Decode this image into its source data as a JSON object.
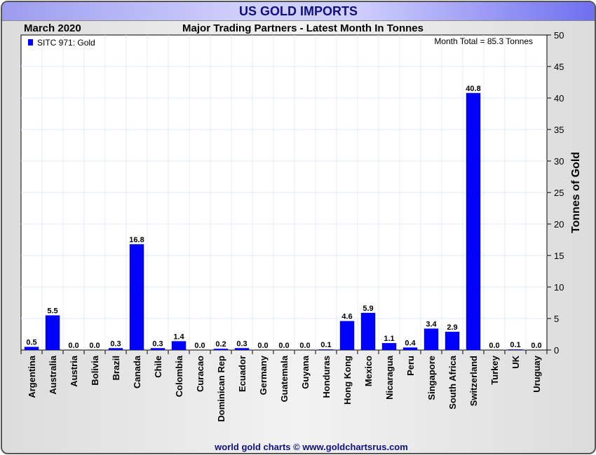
{
  "header": {
    "title": "US GOLD IMPORTS",
    "date": "March 2020",
    "footer": "world gold charts © www.goldchartsrus.com"
  },
  "chart_data": {
    "type": "bar",
    "title": "Major Trading Partners - Latest Month In Tonnes",
    "annotation": "Month Total = 85.3 Tonnes",
    "legend": [
      "SITC 971: Gold"
    ],
    "legend_placement": "top-left",
    "ylabel": "Tonnes of Gold",
    "xlabel": "",
    "ylim": [
      0,
      50
    ],
    "yticks": [
      0,
      5,
      10,
      15,
      20,
      25,
      30,
      35,
      40,
      45,
      50
    ],
    "grid": true,
    "bar_color": "#0000ff",
    "categories": [
      "Argentina",
      "Australia",
      "Austria",
      "Bolivia",
      "Brazil",
      "Canada",
      "Chile",
      "Colombia",
      "Curacao",
      "Dominican Rep",
      "Ecuador",
      "Germany",
      "Guatemala",
      "Guyana",
      "Honduras",
      "Hong Kong",
      "Mexico",
      "Nicaragua",
      "Peru",
      "Singapore",
      "South Africa",
      "Switzerland",
      "Turkey",
      "UK",
      "Uruguay"
    ],
    "values": [
      0.5,
      5.5,
      0.0,
      0.0,
      0.3,
      16.8,
      0.3,
      1.4,
      0.0,
      0.2,
      0.3,
      0.0,
      0.0,
      0.0,
      0.1,
      4.6,
      5.9,
      1.1,
      0.4,
      3.4,
      2.9,
      40.8,
      0.0,
      0.1,
      0.0
    ]
  }
}
